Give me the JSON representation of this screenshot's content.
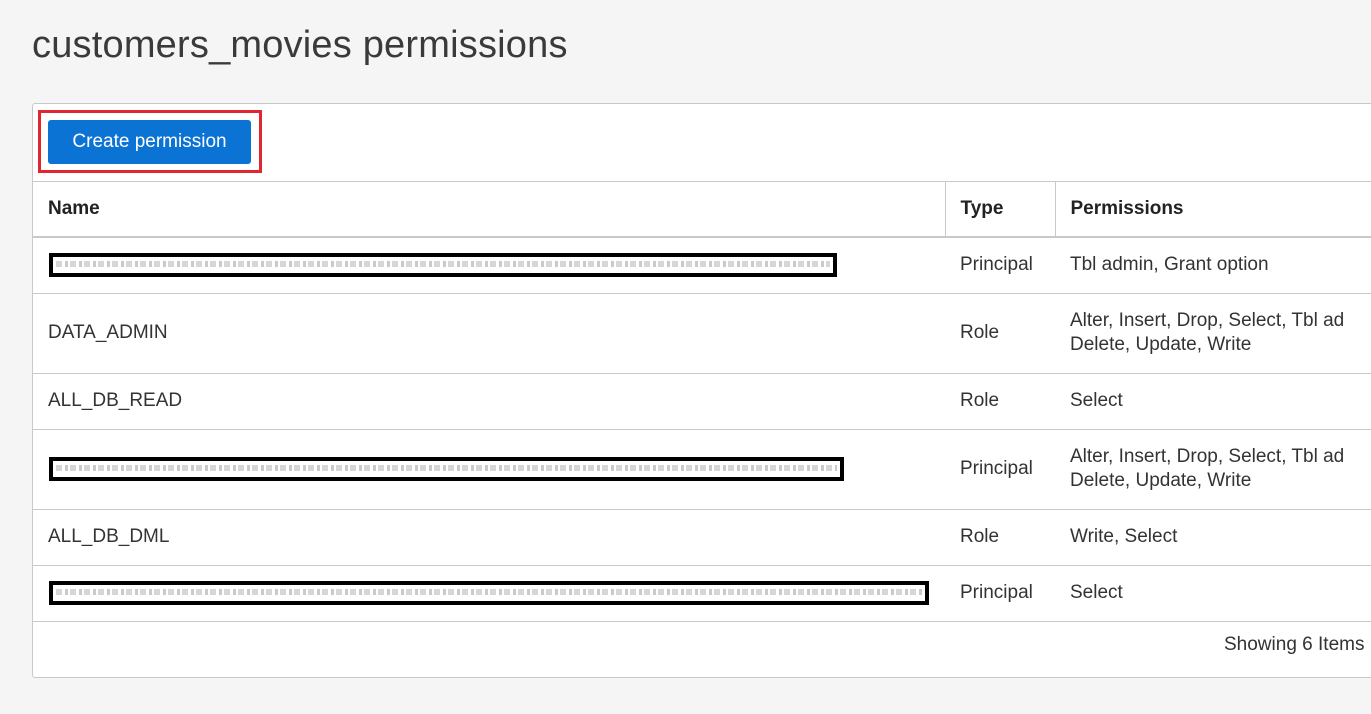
{
  "page": {
    "title": "customers_movies permissions"
  },
  "toolbar": {
    "create_label": "Create permission"
  },
  "table": {
    "headers": [
      "Name",
      "Type",
      "Permissions"
    ],
    "rows": [
      {
        "name": "",
        "name_redacted": true,
        "type": "Principal",
        "permissions": "Tbl admin, Grant option"
      },
      {
        "name": "DATA_ADMIN",
        "name_redacted": false,
        "type": "Role",
        "permissions": "Alter, Insert, Drop, Select, Tbl ad\nDelete, Update, Write"
      },
      {
        "name": "ALL_DB_READ",
        "name_redacted": false,
        "type": "Role",
        "permissions": "Select"
      },
      {
        "name": "",
        "name_redacted": true,
        "type": "Principal",
        "permissions": "Alter, Insert, Drop, Select, Tbl ad\nDelete, Update, Write"
      },
      {
        "name": "ALL_DB_DML",
        "name_redacted": false,
        "type": "Role",
        "permissions": "Write, Select"
      },
      {
        "name": "",
        "name_redacted": true,
        "type": "Principal",
        "permissions": "Select"
      }
    ]
  },
  "footer": {
    "count_text": "Showing 6 Items"
  },
  "colors": {
    "primary_button": "#0b73d3",
    "highlight_border": "#e0262e"
  }
}
